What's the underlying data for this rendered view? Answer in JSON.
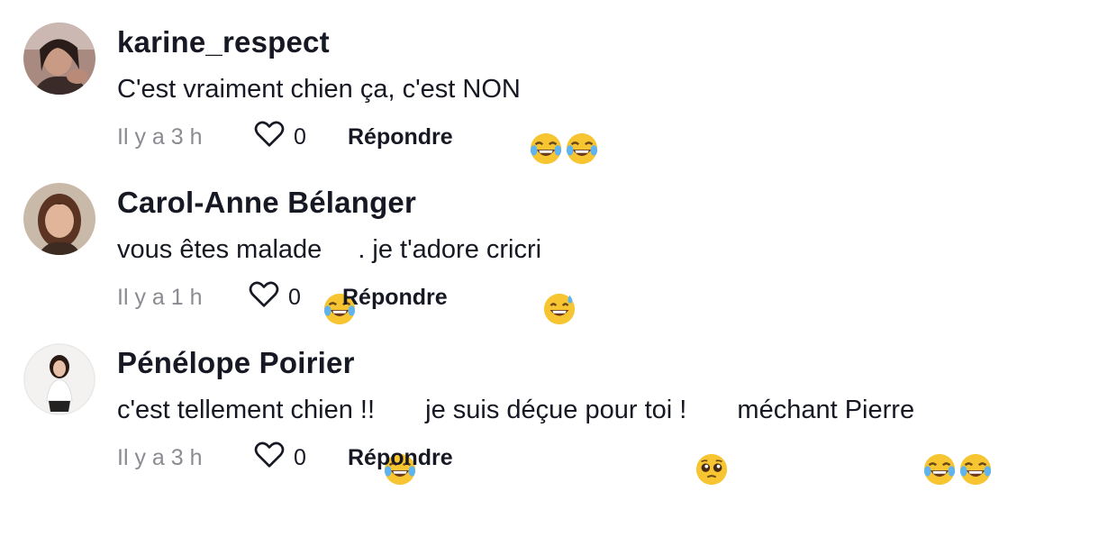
{
  "comments": [
    {
      "username": "karine_respect",
      "text_parts": [
        "C'est vraiment chien ça, c'est NON "
      ],
      "emojis": [
        "face-with-tears-of-joy",
        "face-with-tears-of-joy"
      ],
      "time": "Il y a 3 h",
      "likes": "0",
      "reply_label": "Répondre"
    },
    {
      "username": "Carol-Anne Bélanger",
      "text_parts": [
        "vous êtes malade",
        ". je t'adore cricri"
      ],
      "emojis": [
        "face-with-tears-of-joy",
        "grinning-face-with-sweat"
      ],
      "time": "Il y a 1 h",
      "likes": "0",
      "reply_label": "Répondre"
    },
    {
      "username": "Pénélope Poirier",
      "text_parts": [
        "c'est tellement chien !! ",
        " je suis déçue pour toi ! ",
        " méchant Pierre "
      ],
      "emojis": [
        "face-with-tears-of-joy",
        "pleading-face",
        "face-with-tears-of-joy",
        "face-with-tears-of-joy"
      ],
      "time": "Il y a 3 h",
      "likes": "0",
      "reply_label": "Répondre"
    }
  ],
  "colors": {
    "text": "#161823",
    "muted": "#8a8b91",
    "emoji_yellow": "#f7c531"
  }
}
